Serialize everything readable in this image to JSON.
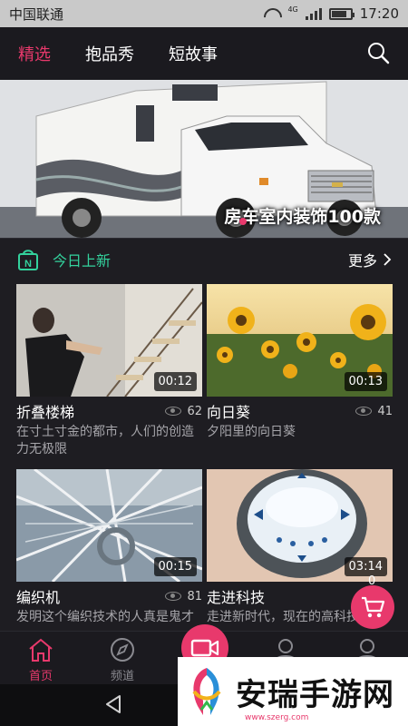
{
  "status_bar": {
    "carrier": "中国联通",
    "network": "4G",
    "time": "17:20",
    "battery_level": 0.8
  },
  "top_nav": {
    "tabs": [
      {
        "label": "精选",
        "active": true
      },
      {
        "label": "抱品秀",
        "active": false
      },
      {
        "label": "短故事",
        "active": false
      }
    ],
    "search_icon": "search-icon"
  },
  "banner": {
    "caption": "房车室内装饰100款"
  },
  "section": {
    "title": "今日上新",
    "more_label": "更多"
  },
  "videos": [
    {
      "title": "折叠楼梯",
      "views": "62",
      "duration": "00:12",
      "desc": "在寸土寸金的都市，人们的创造力无极限"
    },
    {
      "title": "向日葵",
      "views": "41",
      "duration": "00:13",
      "desc": "夕阳里的向日葵"
    },
    {
      "title": "编织机",
      "views": "81",
      "duration": "00:15",
      "desc": "发明这个编织技术的人真是鬼才"
    },
    {
      "title": "走进科技",
      "views": "",
      "duration": "03:14",
      "desc": "走进新时代，现在的高科技"
    }
  ],
  "cart": {
    "count": "0"
  },
  "bottom_nav": {
    "items": [
      {
        "label": "首页",
        "icon": "home-icon",
        "active": true
      },
      {
        "label": "频道",
        "icon": "compass-icon",
        "active": false
      },
      {
        "label": "",
        "icon": "video-camera-icon",
        "active": false
      },
      {
        "label": "",
        "icon": "user-icon",
        "active": false
      },
      {
        "label": "",
        "icon": "user-icon",
        "active": false
      }
    ]
  },
  "watermark": {
    "text": "安瑞手游网",
    "url": "www.szerg.com"
  },
  "colors": {
    "accent": "#e8396c",
    "section_green": "#33d29d",
    "background": "#1e1d22"
  }
}
